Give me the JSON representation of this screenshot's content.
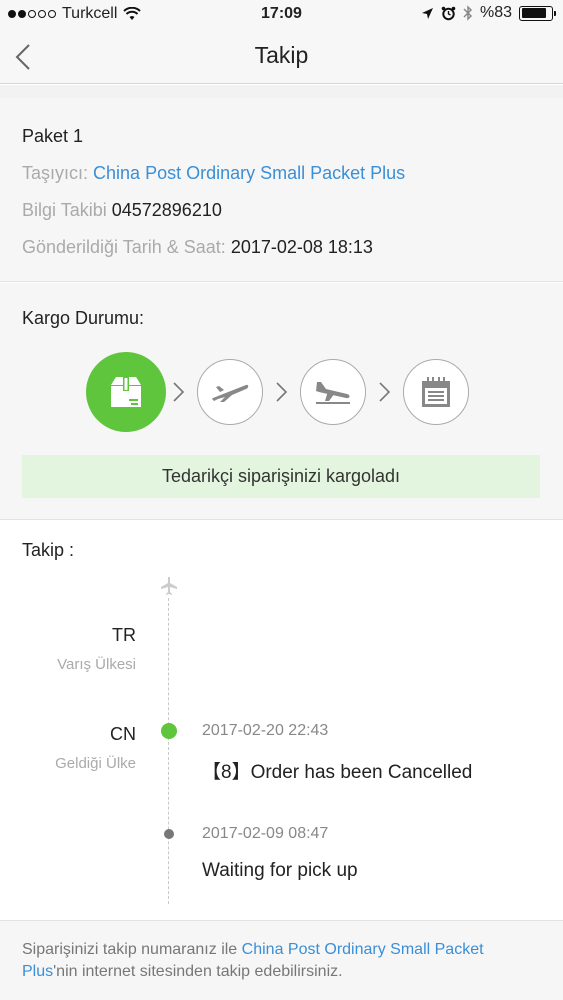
{
  "status_bar": {
    "carrier": "Turkcell",
    "time": "17:09",
    "battery": "%83",
    "battery_level": 0.83,
    "signal_bars_filled": 2,
    "signal_bars_total": 5
  },
  "nav": {
    "title": "Takip",
    "back_icon": "chevron-left-icon"
  },
  "package": {
    "name": "Paket 1",
    "carrier_label": "Taşıyıcı:",
    "carrier_value": "China Post Ordinary Small Packet Plus",
    "tracking_label": "Bilgi Takibi",
    "tracking_value": "04572896210",
    "date_label": "Gönderildiği Tarih & Saat:",
    "date_value": "2017-02-08 18:13"
  },
  "cargo": {
    "title": "Kargo Durumu:",
    "steps": [
      {
        "icon": "package-icon",
        "active": true
      },
      {
        "icon": "plane-takeoff-icon",
        "active": false
      },
      {
        "icon": "plane-landing-icon",
        "active": false
      },
      {
        "icon": "delivered-calendar-icon",
        "active": false
      }
    ],
    "status_text": "Tedarikçi siparişinizi kargoladı"
  },
  "tracking": {
    "title": "Takip :",
    "destination_code": "TR",
    "destination_label": "Varış Ülkesi",
    "origin_code": "CN",
    "origin_label": "Geldiği Ülke",
    "events": [
      {
        "time": "2017-02-20 22:43",
        "text": "【8】Order has been Cancelled"
      },
      {
        "time": "2017-02-09 08:47",
        "text": "Waiting for pick up"
      }
    ]
  },
  "footer": {
    "text_before": "Siparişinizi takip numaranız ile ",
    "link_text": "China Post Ordinary Small Packet Plus",
    "text_after": "'nin internet sitesinden takip edebilirsiniz."
  },
  "colors": {
    "accent_green": "#5ec53c",
    "link_blue": "#3a8fd6",
    "banner_green": "#e3f5de"
  }
}
